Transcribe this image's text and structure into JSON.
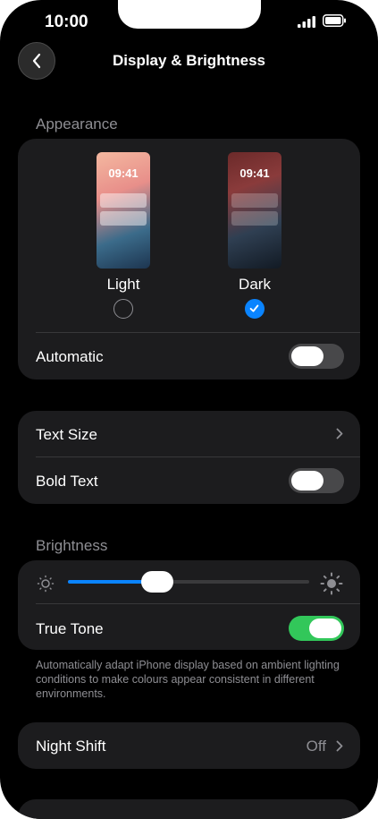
{
  "status_bar": {
    "time": "10:00"
  },
  "nav": {
    "title": "Display & Brightness"
  },
  "appearance": {
    "header": "Appearance",
    "light": {
      "label": "Light",
      "preview_time": "09:41",
      "selected": false
    },
    "dark": {
      "label": "Dark",
      "preview_time": "09:41",
      "selected": true
    },
    "automatic": {
      "label": "Automatic",
      "on": false
    }
  },
  "text_group": {
    "text_size": {
      "label": "Text Size"
    },
    "bold_text": {
      "label": "Bold Text",
      "on": false
    }
  },
  "brightness": {
    "header": "Brightness",
    "level": 0.37,
    "true_tone": {
      "label": "True Tone",
      "on": true
    },
    "footnote": "Automatically adapt iPhone display based on ambient lighting conditions to make colours appear consistent in different environments."
  },
  "night_shift": {
    "label": "Night Shift",
    "value": "Off"
  },
  "colors": {
    "accent": "#0a84ff",
    "toggle_on": "#32c75a",
    "card": "#1c1c1e",
    "secondary_text": "#8e8e93"
  }
}
